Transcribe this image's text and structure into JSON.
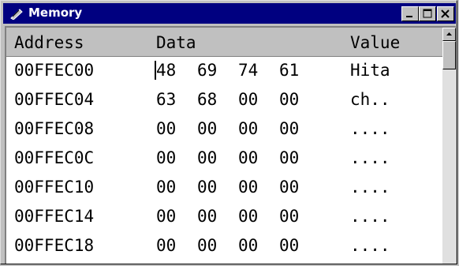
{
  "window": {
    "title": "Memory",
    "icon": "memory-window-icon",
    "controls": [
      "minimize-icon",
      "maximize-icon",
      "close-icon"
    ]
  },
  "table": {
    "headers": {
      "address": "Address",
      "data": "Data",
      "value": "Value"
    },
    "rows": [
      {
        "address": "00FFEC00",
        "bytes": [
          "48",
          "69",
          "74",
          "61"
        ],
        "value": "Hita"
      },
      {
        "address": "00FFEC04",
        "bytes": [
          "63",
          "68",
          "00",
          "00"
        ],
        "value": "ch.."
      },
      {
        "address": "00FFEC08",
        "bytes": [
          "00",
          "00",
          "00",
          "00"
        ],
        "value": "...."
      },
      {
        "address": "00FFEC0C",
        "bytes": [
          "00",
          "00",
          "00",
          "00"
        ],
        "value": "...."
      },
      {
        "address": "00FFEC10",
        "bytes": [
          "00",
          "00",
          "00",
          "00"
        ],
        "value": "...."
      },
      {
        "address": "00FFEC14",
        "bytes": [
          "00",
          "00",
          "00",
          "00"
        ],
        "value": "...."
      },
      {
        "address": "00FFEC18",
        "bytes": [
          "00",
          "00",
          "00",
          "00"
        ],
        "value": "...."
      }
    ]
  },
  "colors": {
    "titlebar": "#000080",
    "face": "#c0c0c0",
    "content": "#ffffff"
  }
}
